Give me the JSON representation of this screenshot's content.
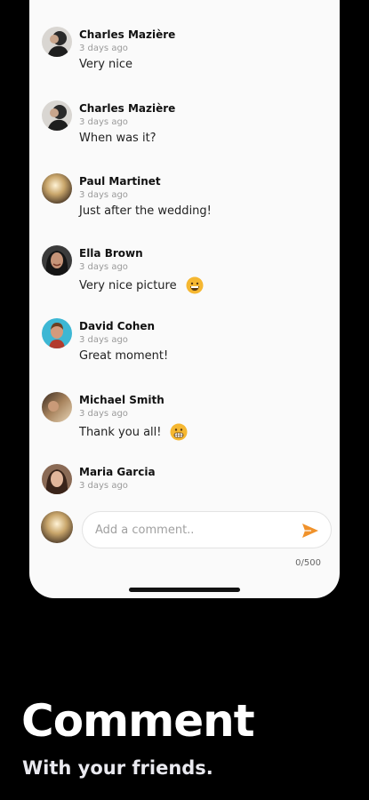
{
  "comments": [
    {
      "name": "Charles Mazière",
      "time": "3 days ago",
      "text": "Very nice",
      "avatar": "avatar-charles-icon"
    },
    {
      "name": "Charles Mazière",
      "time": "3 days ago",
      "text": "When was it?",
      "avatar": "avatar-charles-icon"
    },
    {
      "name": "Paul Martinet",
      "time": "3 days ago",
      "text": "Just after the wedding!",
      "avatar": "avatar-paul-icon"
    },
    {
      "name": "Ella Brown",
      "time": "3 days ago",
      "text": "Very nice picture",
      "avatar": "avatar-ella-icon",
      "emoji": "grinning-emoji-icon"
    },
    {
      "name": "David Cohen",
      "time": "3 days ago",
      "text": "Great moment!",
      "avatar": "avatar-david-icon"
    },
    {
      "name": "Michael Smith",
      "time": "3 days ago",
      "text": "Thank you all!",
      "avatar": "avatar-michael-icon",
      "emoji": "grimacing-emoji-icon"
    },
    {
      "name": "Maria Garcia",
      "time": "3 days ago",
      "text": "",
      "avatar": "avatar-maria-icon"
    }
  ],
  "composer": {
    "placeholder": "Add a comment..",
    "value": "",
    "counter": "0/500",
    "send_icon": "send-icon",
    "accent": "#f0922b"
  },
  "promo": {
    "title": "Comment",
    "subtitle": "With your friends."
  }
}
